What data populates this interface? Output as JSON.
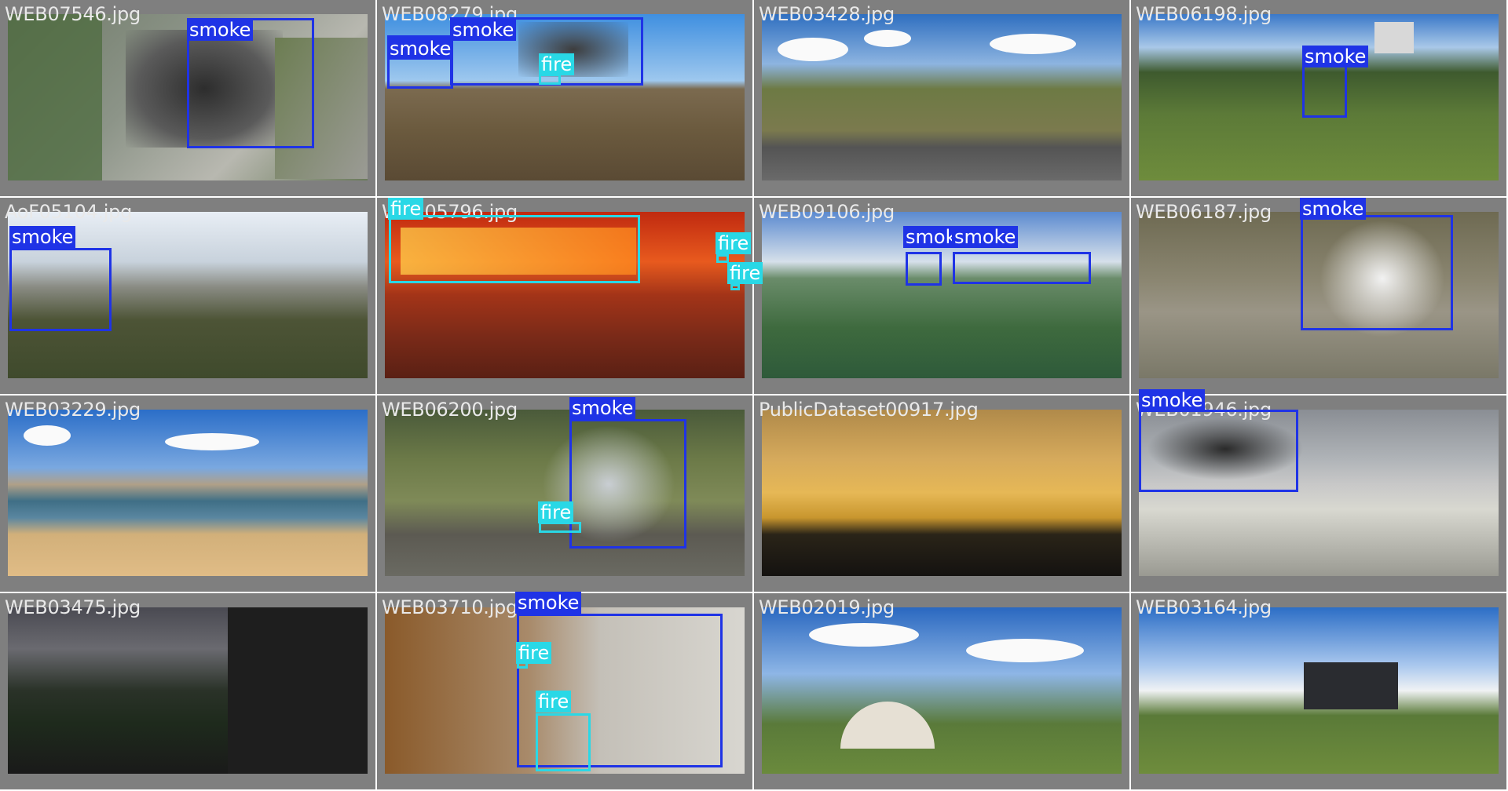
{
  "class_colors": {
    "smoke": "#1f33e6",
    "fire": "#29d8e6"
  },
  "tiles": [
    {
      "file": "WEB07546.jpg",
      "labels": [
        "smoke"
      ]
    },
    {
      "file": "WEB08279.jpg",
      "labels": [
        "smoke",
        "smoke",
        "fire"
      ]
    },
    {
      "file": "WEB03428.jpg",
      "labels": []
    },
    {
      "file": "WEB06198.jpg",
      "labels": [
        "smoke"
      ]
    },
    {
      "file": "AoF05104.jpg",
      "labels": [
        "smoke"
      ]
    },
    {
      "file": "WEB05796.jpg",
      "labels": [
        "fire",
        "fire",
        "fire"
      ]
    },
    {
      "file": "WEB09106.jpg",
      "labels": [
        "smoke",
        "smoke"
      ]
    },
    {
      "file": "WEB06187.jpg",
      "labels": [
        "smoke"
      ]
    },
    {
      "file": "WEB03229.jpg",
      "labels": []
    },
    {
      "file": "WEB06200.jpg",
      "labels": [
        "smoke",
        "fire"
      ]
    },
    {
      "file": "PublicDataset00917.jpg",
      "labels": []
    },
    {
      "file": "WEB01946.jpg",
      "labels": [
        "smoke"
      ]
    },
    {
      "file": "WEB03475.jpg",
      "labels": []
    },
    {
      "file": "WEB03710.jpg",
      "labels": [
        "smoke",
        "fire",
        "fire"
      ]
    },
    {
      "file": "WEB02019.jpg",
      "labels": []
    },
    {
      "file": "WEB03164.jpg",
      "labels": []
    }
  ]
}
